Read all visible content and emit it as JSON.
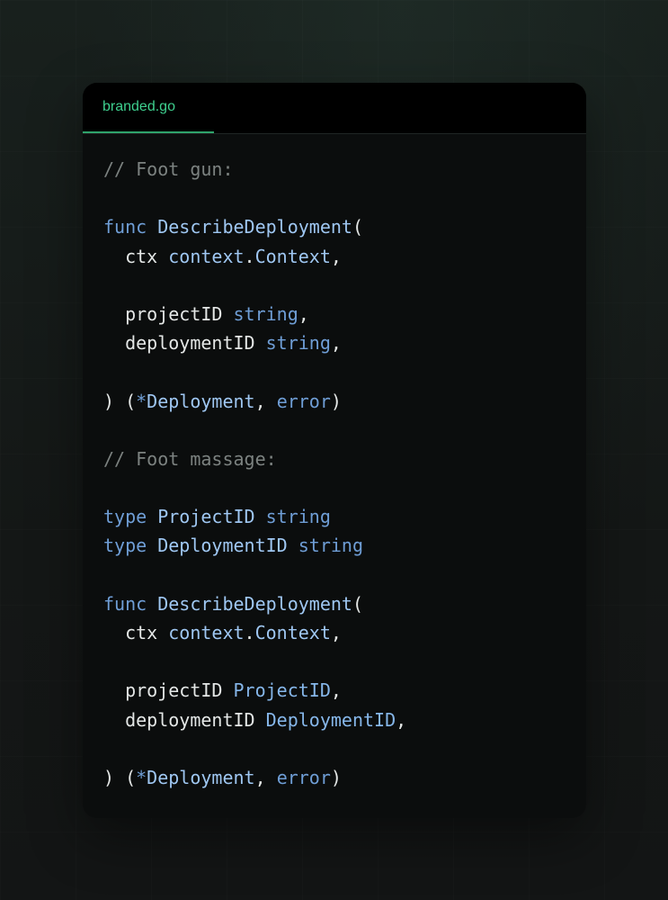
{
  "file_tab": {
    "label": "branded.go"
  },
  "code_lines": [
    [
      {
        "t": "// Foot gun:",
        "c": "comment"
      }
    ],
    [],
    [
      {
        "t": "func",
        "c": "kw"
      },
      {
        "t": " ",
        "c": "plain"
      },
      {
        "t": "DescribeDeployment",
        "c": "fn"
      },
      {
        "t": "(",
        "c": "plain"
      }
    ],
    [
      {
        "t": "  ctx ",
        "c": "plain"
      },
      {
        "t": "context",
        "c": "fn"
      },
      {
        "t": ".",
        "c": "plain"
      },
      {
        "t": "Context",
        "c": "fn"
      },
      {
        "t": ",",
        "c": "plain"
      }
    ],
    [],
    [
      {
        "t": "  projectID ",
        "c": "plain"
      },
      {
        "t": "string",
        "c": "kw"
      },
      {
        "t": ",",
        "c": "plain"
      }
    ],
    [
      {
        "t": "  deploymentID ",
        "c": "plain"
      },
      {
        "t": "string",
        "c": "kw"
      },
      {
        "t": ",",
        "c": "plain"
      }
    ],
    [],
    [
      {
        "t": ") (",
        "c": "plain"
      },
      {
        "t": "*",
        "c": "kw"
      },
      {
        "t": "Deployment",
        "c": "fn"
      },
      {
        "t": ", ",
        "c": "plain"
      },
      {
        "t": "error",
        "c": "kw"
      },
      {
        "t": ")",
        "c": "plain"
      }
    ],
    [],
    [
      {
        "t": "// Foot massage:",
        "c": "comment"
      }
    ],
    [],
    [
      {
        "t": "type",
        "c": "kw"
      },
      {
        "t": " ",
        "c": "plain"
      },
      {
        "t": "ProjectID",
        "c": "fn"
      },
      {
        "t": " ",
        "c": "plain"
      },
      {
        "t": "string",
        "c": "kw"
      }
    ],
    [
      {
        "t": "type",
        "c": "kw"
      },
      {
        "t": " ",
        "c": "plain"
      },
      {
        "t": "DeploymentID",
        "c": "fn"
      },
      {
        "t": " ",
        "c": "plain"
      },
      {
        "t": "string",
        "c": "kw"
      }
    ],
    [],
    [
      {
        "t": "func",
        "c": "kw"
      },
      {
        "t": " ",
        "c": "plain"
      },
      {
        "t": "DescribeDeployment",
        "c": "fn"
      },
      {
        "t": "(",
        "c": "plain"
      }
    ],
    [
      {
        "t": "  ctx ",
        "c": "plain"
      },
      {
        "t": "context",
        "c": "fn"
      },
      {
        "t": ".",
        "c": "plain"
      },
      {
        "t": "Context",
        "c": "fn"
      },
      {
        "t": ",",
        "c": "plain"
      }
    ],
    [],
    [
      {
        "t": "  projectID ",
        "c": "plain"
      },
      {
        "t": "ProjectID",
        "c": "type"
      },
      {
        "t": ",",
        "c": "plain"
      }
    ],
    [
      {
        "t": "  deploymentID ",
        "c": "plain"
      },
      {
        "t": "DeploymentID",
        "c": "type"
      },
      {
        "t": ",",
        "c": "plain"
      }
    ],
    [],
    [
      {
        "t": ") (",
        "c": "plain"
      },
      {
        "t": "*",
        "c": "kw"
      },
      {
        "t": "Deployment",
        "c": "fn"
      },
      {
        "t": ", ",
        "c": "plain"
      },
      {
        "t": "error",
        "c": "kw"
      },
      {
        "t": ")",
        "c": "plain"
      }
    ]
  ],
  "colors": {
    "background": "#161a19",
    "card": "#0b0d0d",
    "tab_bar": "#000000",
    "tab_accent": "#3ecf8e",
    "comment": "#7c8280",
    "keyword": "#6f9ed6",
    "function": "#9fc7f2",
    "type": "#86b7ea",
    "text": "#e4e7e6"
  }
}
